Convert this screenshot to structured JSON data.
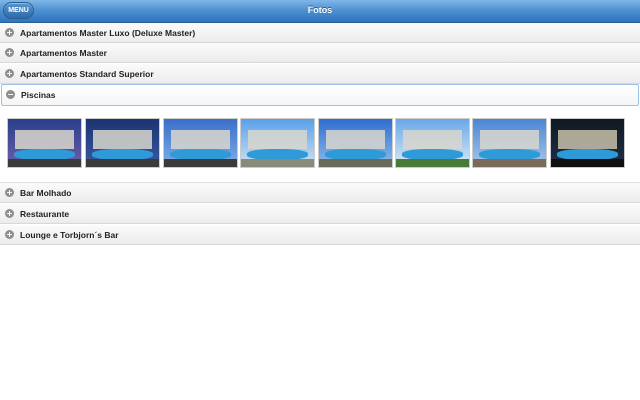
{
  "header": {
    "menu_label": "MENU",
    "title": "Fotos"
  },
  "sections": [
    {
      "label": "Apartamentos Master Luxo (Deluxe Master)",
      "expanded": false
    },
    {
      "label": "Apartamentos Master",
      "expanded": false
    },
    {
      "label": "Apartamentos Standard Superior",
      "expanded": false
    },
    {
      "label": "Piscinas",
      "expanded": true
    },
    {
      "label": "Bar Molhado",
      "expanded": false
    },
    {
      "label": "Restaurante",
      "expanded": false
    },
    {
      "label": "Lounge e Torbjorn´s Bar",
      "expanded": false
    }
  ],
  "icons": {
    "collapsed": "plus-circle-icon",
    "expanded": "minus-circle-icon"
  },
  "gallery": {
    "photo_count": 8,
    "sky_colors": [
      "#2a3f8a",
      "#1c3370",
      "#3a6fc8",
      "#5aa0e8",
      "#2f6ed0",
      "#6aa8e6",
      "#4a86d4",
      "#101820"
    ]
  },
  "colors": {
    "header_blue": "#4a8fd0",
    "expanded_border": "#9ec1e6"
  }
}
